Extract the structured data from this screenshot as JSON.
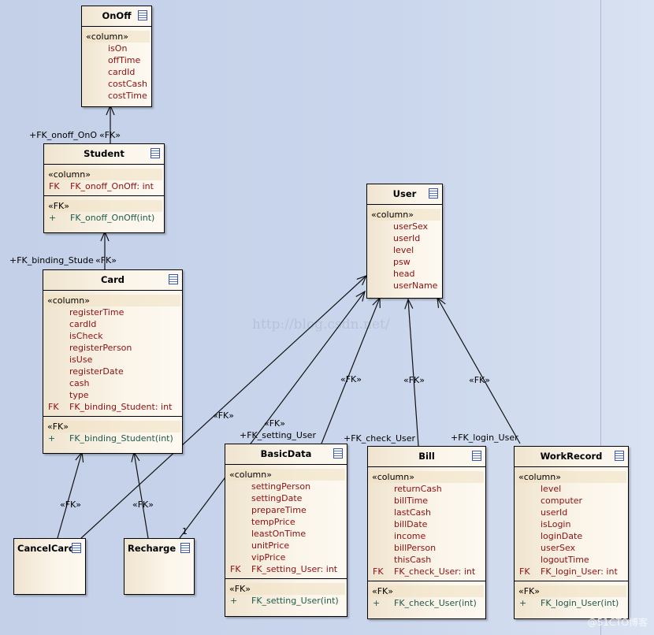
{
  "classes": [
    {
      "id": "OnOff",
      "name": "OnOff",
      "columns_stereotype": "«column»",
      "columns": [
        {
          "prefix": "",
          "name": "isOn"
        },
        {
          "prefix": "",
          "name": "offTime"
        },
        {
          "prefix": "",
          "name": "cardId"
        },
        {
          "prefix": "",
          "name": "costCash"
        },
        {
          "prefix": "",
          "name": "costTime"
        }
      ],
      "operations_stereotype": "",
      "operations": []
    },
    {
      "id": "Student",
      "name": "Student",
      "columns_stereotype": "«column»",
      "columns": [
        {
          "prefix": "FK",
          "name": "FK_onoff_OnOff: int"
        }
      ],
      "operations_stereotype": "«FK»",
      "operations": [
        {
          "prefix": "+",
          "name": "FK_onoff_OnOff(int)"
        }
      ]
    },
    {
      "id": "Card",
      "name": "Card",
      "columns_stereotype": "«column»",
      "columns": [
        {
          "prefix": "",
          "name": "registerTime"
        },
        {
          "prefix": "",
          "name": "cardId"
        },
        {
          "prefix": "",
          "name": "isCheck"
        },
        {
          "prefix": "",
          "name": "registerPerson"
        },
        {
          "prefix": "",
          "name": "isUse"
        },
        {
          "prefix": "",
          "name": "registerDate"
        },
        {
          "prefix": "",
          "name": "cash"
        },
        {
          "prefix": "",
          "name": "type"
        },
        {
          "prefix": "FK",
          "name": "FK_binding_Student: int"
        }
      ],
      "operations_stereotype": "«FK»",
      "operations": [
        {
          "prefix": "+",
          "name": "FK_binding_Student(int)"
        }
      ]
    },
    {
      "id": "User",
      "name": "User",
      "columns_stereotype": "«column»",
      "columns": [
        {
          "prefix": "",
          "name": "userSex"
        },
        {
          "prefix": "",
          "name": "userId"
        },
        {
          "prefix": "",
          "name": "level"
        },
        {
          "prefix": "",
          "name": "psw"
        },
        {
          "prefix": "",
          "name": "head"
        },
        {
          "prefix": "",
          "name": "userName"
        }
      ],
      "operations_stereotype": "",
      "operations": []
    },
    {
      "id": "BasicData",
      "name": "BasicData",
      "columns_stereotype": "«column»",
      "columns": [
        {
          "prefix": "",
          "name": "settingPerson"
        },
        {
          "prefix": "",
          "name": "settingDate"
        },
        {
          "prefix": "",
          "name": "prepareTime"
        },
        {
          "prefix": "",
          "name": "tempPrice"
        },
        {
          "prefix": "",
          "name": "leastOnTime"
        },
        {
          "prefix": "",
          "name": "unitPrice"
        },
        {
          "prefix": "",
          "name": "vipPrice"
        },
        {
          "prefix": "FK",
          "name": "FK_setting_User: int"
        }
      ],
      "operations_stereotype": "«FK»",
      "operations": [
        {
          "prefix": "+",
          "name": "FK_setting_User(int)"
        }
      ]
    },
    {
      "id": "Bill",
      "name": "Bill",
      "columns_stereotype": "«column»",
      "columns": [
        {
          "prefix": "",
          "name": "returnCash"
        },
        {
          "prefix": "",
          "name": "billTime"
        },
        {
          "prefix": "",
          "name": "lastCash"
        },
        {
          "prefix": "",
          "name": "billDate"
        },
        {
          "prefix": "",
          "name": "income"
        },
        {
          "prefix": "",
          "name": "billPerson"
        },
        {
          "prefix": "",
          "name": "thisCash"
        },
        {
          "prefix": "FK",
          "name": "FK_check_User: int"
        }
      ],
      "operations_stereotype": "«FK»",
      "operations": [
        {
          "prefix": "+",
          "name": "FK_check_User(int)"
        }
      ]
    },
    {
      "id": "WorkRecord",
      "name": "WorkRecord",
      "columns_stereotype": "«column»",
      "columns": [
        {
          "prefix": "",
          "name": "level"
        },
        {
          "prefix": "",
          "name": "computer"
        },
        {
          "prefix": "",
          "name": "userId"
        },
        {
          "prefix": "",
          "name": "isLogin"
        },
        {
          "prefix": "",
          "name": "loginDate"
        },
        {
          "prefix": "",
          "name": "userSex"
        },
        {
          "prefix": "",
          "name": "logoutTime"
        },
        {
          "prefix": "FK",
          "name": "FK_login_User: int"
        }
      ],
      "operations_stereotype": "«FK»",
      "operations": [
        {
          "prefix": "+",
          "name": "FK_login_User(int)"
        }
      ]
    },
    {
      "id": "CancelCard",
      "name": "CancelCard",
      "columns_stereotype": "",
      "columns": [],
      "operations_stereotype": "",
      "operations": []
    },
    {
      "id": "Recharge",
      "name": "Recharge",
      "columns_stereotype": "",
      "columns": [],
      "operations_stereotype": "",
      "operations": []
    }
  ],
  "connectors": [
    {
      "id": "student-onoff",
      "source": "Student",
      "target": "OnOff",
      "stereotype": "«FK»",
      "role": "+FK_onoff_OnO",
      "multiplicity": ""
    },
    {
      "id": "card-student",
      "source": "Card",
      "target": "Student",
      "stereotype": "«FK»",
      "role": "+FK_binding_Stude",
      "multiplicity": ""
    },
    {
      "id": "cancelcard-card",
      "source": "CancelCard",
      "target": "Card",
      "stereotype": "«FK»",
      "role": "",
      "multiplicity": ""
    },
    {
      "id": "recharge-card",
      "source": "Recharge",
      "target": "Card",
      "stereotype": "«FK»",
      "role": "",
      "multiplicity": ""
    },
    {
      "id": "cancelcard-user",
      "source": "CancelCard",
      "target": "User",
      "stereotype": "«FK»",
      "role": "",
      "multiplicity": ""
    },
    {
      "id": "recharge-user",
      "source": "Recharge",
      "target": "User",
      "stereotype": "«FK»",
      "role": "+FK_setting_User",
      "multiplicity": "1"
    },
    {
      "id": "basicdata-user",
      "source": "BasicData",
      "target": "User",
      "stereotype": "«FK»",
      "role": "",
      "multiplicity": ""
    },
    {
      "id": "bill-user",
      "source": "Bill",
      "target": "User",
      "stereotype": "«FK»",
      "role": "+FK_check_User",
      "multiplicity": ""
    },
    {
      "id": "workrecord-user",
      "source": "WorkRecord",
      "target": "User",
      "stereotype": "«FK»",
      "role": "+FK_login_User",
      "multiplicity": ""
    }
  ],
  "watermarks": {
    "center": "http://blog.csdn.net/",
    "corner": "@51CTO博客"
  },
  "colors": {
    "background": "#c5d2ea",
    "class_fill": "#fbf5ea",
    "attribute": "#8b1010",
    "operation": "#1f5a4a"
  }
}
